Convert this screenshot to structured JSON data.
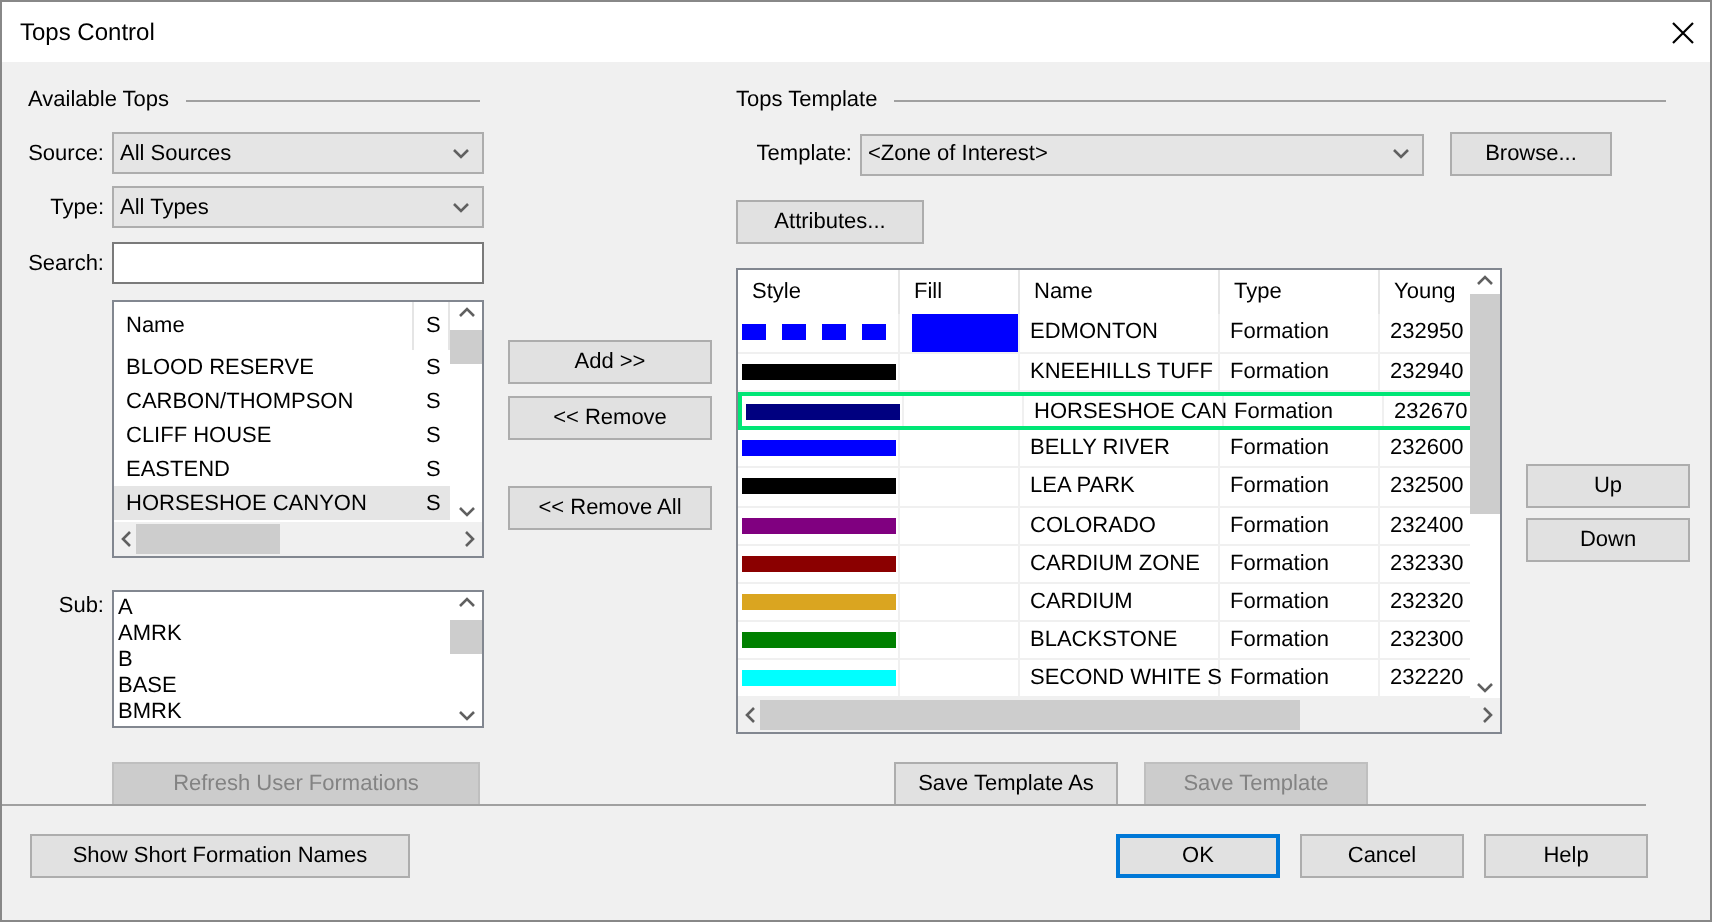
{
  "window": {
    "title": "Tops Control"
  },
  "available_tops": {
    "heading": "Available Tops",
    "source": {
      "label": "Source:",
      "value": "All Sources"
    },
    "type": {
      "label": "Type:",
      "value": "All Types"
    },
    "search": {
      "label": "Search:"
    },
    "list": {
      "columns": [
        "Name",
        "S"
      ],
      "rows": [
        {
          "name": "BLOOD RESERVE",
          "column_2": "S",
          "selected": false
        },
        {
          "name": "CARBON/THOMPSON",
          "column_2": "S",
          "selected": false
        },
        {
          "name": "CLIFF HOUSE",
          "column_2": "S",
          "selected": false
        },
        {
          "name": "EASTEND",
          "column_2": "S",
          "selected": false
        },
        {
          "name": "HORSESHOE CANYON",
          "column_2": "S",
          "selected": true
        }
      ]
    },
    "sub": {
      "label": "Sub:",
      "items": [
        "A",
        "AMRK",
        "B",
        "BASE",
        "BMRK"
      ]
    },
    "refresh_button": {
      "label": "Refresh User Formations",
      "disabled": true
    }
  },
  "transfer_buttons": [
    "Add >>",
    "<<  Remove",
    "<<  Remove All"
  ],
  "tops_template": {
    "heading": "Tops Template",
    "template": {
      "label": "Template:",
      "value": "<Zone of Interest>"
    },
    "browse_button": "Browse...",
    "attributes_button": "Attributes...",
    "table": {
      "columns": [
        "Style",
        "Fill",
        "Name",
        "Type",
        "Young"
      ],
      "rows": [
        {
          "style": {
            "color": "#0000ff",
            "dashed": true
          },
          "fill": {
            "color": "#0000ff"
          },
          "name": "EDMONTON",
          "type": "Formation",
          "young": "232950",
          "selected": false
        },
        {
          "style": {
            "color": "#000000",
            "dashed": false
          },
          "name": "KNEEHILLS TUFF",
          "type": "Formation",
          "young": "232940",
          "selected": false
        },
        {
          "style": {
            "color": "#000080",
            "dashed": false
          },
          "name": "HORSESHOE CAN",
          "type": "Formation",
          "young": "232670",
          "selected": true
        },
        {
          "style": {
            "color": "#0000ff",
            "dashed": false
          },
          "name": "BELLY RIVER",
          "type": "Formation",
          "young": "232600",
          "selected": false
        },
        {
          "style": {
            "color": "#000000",
            "dashed": false
          },
          "name": "LEA PARK",
          "type": "Formation",
          "young": "232500",
          "selected": false
        },
        {
          "style": {
            "color": "#800080",
            "dashed": false
          },
          "name": "COLORADO",
          "type": "Formation",
          "young": "232400",
          "selected": false
        },
        {
          "style": {
            "color": "#8b0000",
            "dashed": false
          },
          "name": "CARDIUM ZONE",
          "type": "Formation",
          "young": "232330",
          "selected": false
        },
        {
          "style": {
            "color": "#daa520",
            "dashed": false
          },
          "name": "CARDIUM",
          "type": "Formation",
          "young": "232320",
          "selected": false
        },
        {
          "style": {
            "color": "#008000",
            "dashed": false
          },
          "name": "BLACKSTONE",
          "type": "Formation",
          "young": "232300",
          "selected": false
        },
        {
          "style": {
            "color": "#00ffff",
            "dashed": false
          },
          "name": "SECOND WHITE S",
          "type": "Formation",
          "young": "232220",
          "selected": false
        }
      ]
    },
    "order_buttons": [
      "Up",
      "Down"
    ],
    "save_buttons": [
      {
        "label": "Save Template As",
        "disabled": false
      },
      {
        "label": "Save Template",
        "disabled": true
      }
    ]
  },
  "footer": {
    "short_names_button": "Show Short Formation Names",
    "buttons": [
      {
        "label": "OK",
        "default": true
      },
      {
        "label": "Cancel",
        "default": false
      },
      {
        "label": "Help",
        "default": false
      }
    ]
  }
}
